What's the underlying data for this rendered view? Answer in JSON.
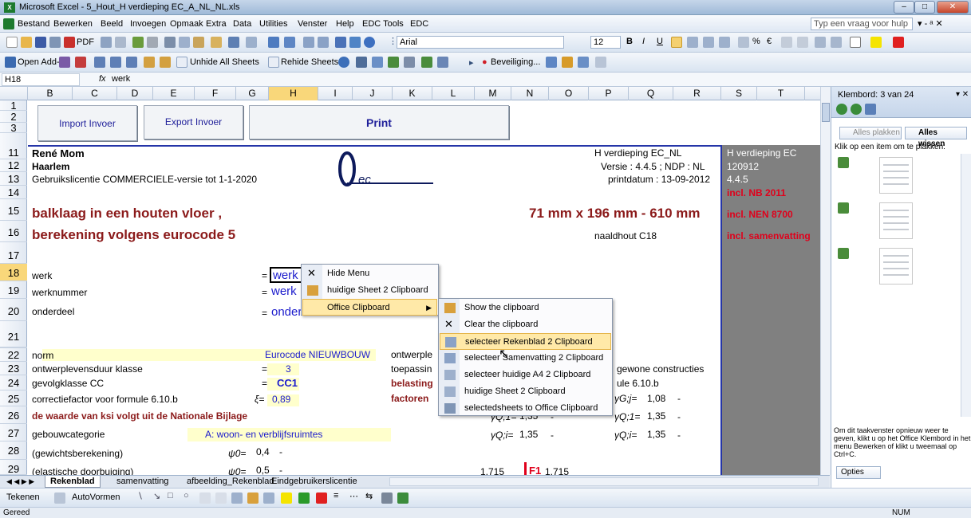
{
  "window": {
    "title": "Microsoft Excel - 5_Hout_H verdieping EC_A_NL_NL.xls",
    "app_icon": "excel-icon"
  },
  "menu": {
    "items": [
      "Bestand",
      "Bewerken",
      "Beeld",
      "Invoegen",
      "Opmaak",
      "Extra",
      "Data",
      "Utilities",
      "Venster",
      "Help",
      "EDC Tools",
      "EDC"
    ],
    "help_placeholder": "Typ een vraag voor hulp"
  },
  "toolbar": {
    "pdf_label": "PDF",
    "font": "Arial",
    "size": "12"
  },
  "toolbar2": {
    "open_addin": "Open Add-in",
    "unhide": "Unhide All Sheets",
    "rehide": "Rehide Sheets",
    "beveiliging": "Beveiliging..."
  },
  "formula": {
    "namebox": "H18",
    "fx": "fx",
    "value": "werk"
  },
  "columns": [
    "B",
    "C",
    "D",
    "E",
    "F",
    "G",
    "H",
    "I",
    "J",
    "K",
    "L",
    "M",
    "N",
    "O",
    "P",
    "Q",
    "R",
    "S",
    "T"
  ],
  "rows": [
    "1",
    "2",
    "3",
    "11",
    "12",
    "13",
    "14",
    "15",
    "16",
    "17",
    "18",
    "19",
    "20",
    "21",
    "22",
    "23",
    "24",
    "25",
    "26",
    "27",
    "28",
    "29"
  ],
  "buttons": {
    "import": "Import Invoer",
    "export": "Export Invoer",
    "print": "Print"
  },
  "sheet": {
    "name": "René Mom",
    "city": "Haarlem",
    "licence": "Gebruikslicentie COMMERCIELE-versie tot 1-1-2020",
    "h_verdieping": "H verdieping EC_NL",
    "h_verdieping2": "H verdieping EC",
    "versie": "Versie : 4.4.5 ; NDP : NL",
    "versie_val": "120912",
    "printdatum": "printdatum : 13-09-2012",
    "printdatum_val": "4.4.5",
    "nb2011": "incl. NB 2011",
    "nen8700": "incl. NEN 8700",
    "samenvatting": "incl. samenvatting",
    "title1": "balklaag in een houten vloer ,",
    "title2": "berekening volgens eurocode 5",
    "dims": "71 mm x 196 mm - 610 mm",
    "hout": "naaldhout C18",
    "werk": "werk",
    "werknummer": "werknummer",
    "onderdeel": "onderdeel",
    "eq": "=",
    "werk_val": "werk",
    "werknummer_val": "werk",
    "onderdeel_val": "onderdeel",
    "norm": "norm",
    "norm_val": "Eurocode NIEUWBOUW",
    "ontwerple": "ontwerple",
    "levensduur": "ontwerplevensduur klasse",
    "levensduur_val": "3",
    "toepassing": "toepassin",
    "gewone": "gewone constructies",
    "gevolgklasse": "gevolgklasse CC",
    "cc_val": "CC1",
    "belasting": "belasting",
    "formule610": "ule 6.10.b",
    "correctie": "correctiefactor voor formule 6.10.b",
    "xi": "ξ=",
    "xi_val": "0,89",
    "factoren": "factoren",
    "gamma_gj": "γG;j=",
    "gamma_gj_val": "1,08",
    "ksi_note": "de waarde van ksi volgt uit de Nationale Bijlage",
    "gq1": "γQ;1=",
    "gq1_val": "1,35",
    "gq1b": "γQ;1=",
    "gq1b_val": "1,35",
    "gebouw": "gebouwcategorie",
    "gebouw_val": "A: woon- en verblijfsruimtes",
    "gqi": "γQ;i=",
    "gqi_val": "1,35",
    "gqib": "γQ;i=",
    "gqib_val": "1,35",
    "gewicht": "(gewichtsberekening)",
    "psi0": "ψ0=",
    "psi0_val": "0,4",
    "elastisch": "(elastische doorbuiging)",
    "psi": "ψ0=",
    "psi_val": "0,5",
    "v1715": "1.715",
    "f1": "F1",
    "v1715b": "1.715",
    "dash": "-"
  },
  "context_menu": {
    "items": [
      "Hide Menu",
      "huidige Sheet 2 Clipboard",
      "Office Clipboard"
    ]
  },
  "submenu": {
    "items": [
      "Show the clipboard",
      "Clear the clipboard",
      "selecteer Rekenblad 2 Clipboard",
      "selecteer Samenvatting 2 Clipboard",
      "selecteer huidige A4 2 Clipboard",
      "huidige Sheet 2 Clipboard",
      "selectedsheets to Office Clipboard"
    ],
    "highlighted": "selecteer Rekenblad 2 Clipboard"
  },
  "tabs": [
    "Rekenblad",
    "samenvatting",
    "afbeelding_Rekenblad",
    "Eindgebruikerslicentie"
  ],
  "drawbar": {
    "tekenen": "Tekenen",
    "autovormen": "AutoVormen"
  },
  "status": {
    "left": "Gereed",
    "num": "NUM"
  },
  "taskpane": {
    "title": "Klembord: 3 van 24",
    "paste_all": "Alles plakken",
    "clear_all": "Alles wissen",
    "hint": "Klik op een item om te plakken:",
    "footer": "Om dit taakvenster opnieuw weer te geven, klikt u op het Office Klembord in het menu Bewerken of klikt u tweemaal op Ctrl+C.",
    "options": "Opties"
  },
  "colors": {
    "accent": "#1b1bcc",
    "darkred": "#8b1a1a",
    "red": "#e0001b",
    "highlight": "#ffe9a8"
  }
}
